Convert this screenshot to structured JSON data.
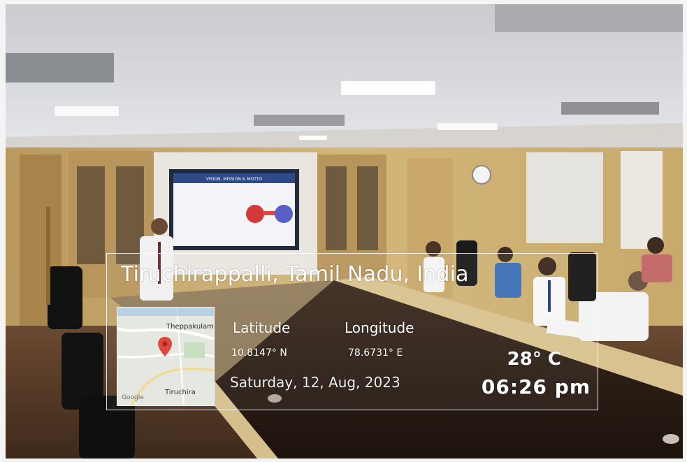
{
  "photo": {
    "screen_slide_title": "VISION, MISSION & MOTTO"
  },
  "overlay": {
    "location": "Tiruchirappalli, Tamil Nadu, India",
    "latitude_label": "Latitude",
    "latitude_value": "10.8147° N",
    "longitude_label": "Longitude",
    "longitude_value": "78.6731° E",
    "date": "Saturday, 12, Aug, 2023",
    "temperature": "28° C",
    "time": "06:26 pm",
    "map": {
      "place_label_1": "Theppakulam",
      "place_label_2": "Tiruchira",
      "brand": "Google",
      "pin_color": "#e0473c"
    }
  }
}
